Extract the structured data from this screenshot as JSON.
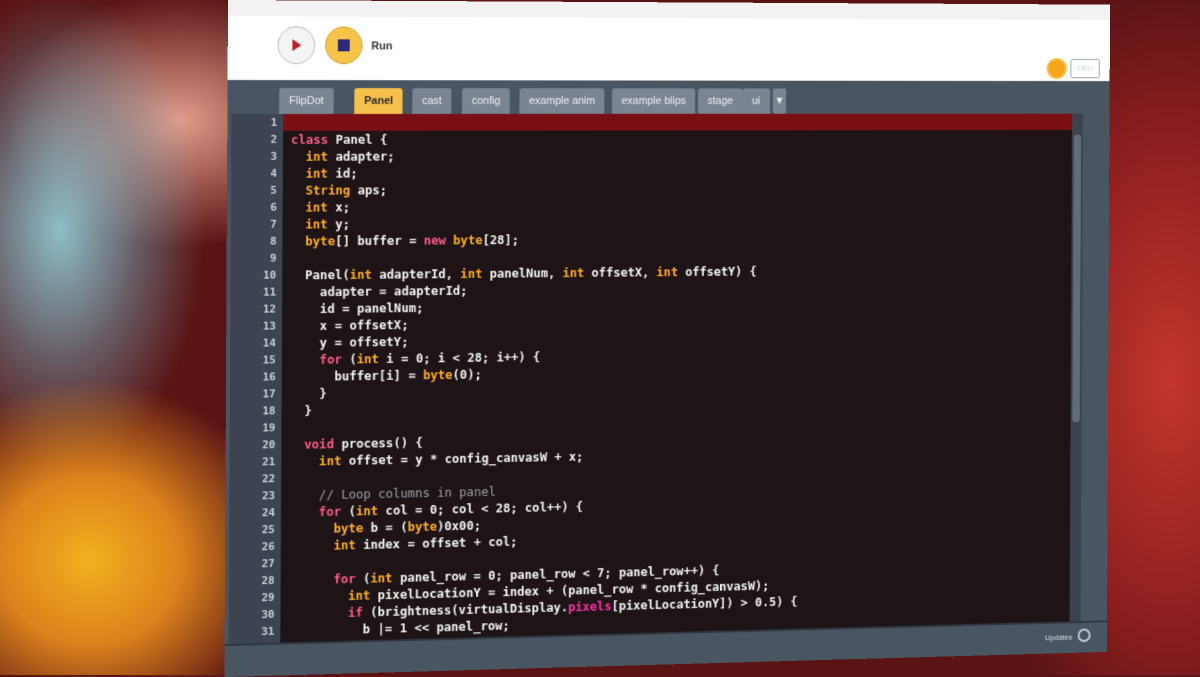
{
  "toolbar": {
    "title": "Run",
    "lang_label": "DEU"
  },
  "tabs": [
    {
      "label": "FlipDot",
      "active": false
    },
    {
      "label": "Panel",
      "active": true
    },
    {
      "label": "cast",
      "active": false
    },
    {
      "label": "config",
      "active": false
    },
    {
      "label": "example anim",
      "active": false
    },
    {
      "label": "example blips",
      "active": false
    },
    {
      "label": "stage",
      "active": false
    },
    {
      "label": "ui",
      "active": false
    }
  ],
  "editor": {
    "current_line": 1,
    "lines": [
      "",
      "class Panel {",
      "  int adapter;",
      "  int id;",
      "  String aps;",
      "  int x;",
      "  int y;",
      "  byte[] buffer = new byte[28];",
      "",
      "  Panel(int adapterId, int panelNum, int offsetX, int offsetY) {",
      "    adapter = adapterId;",
      "    id = panelNum;",
      "    x = offsetX;",
      "    y = offsetY;",
      "    for (int i = 0; i < 28; i++) {",
      "      buffer[i] = byte(0);",
      "    }",
      "  }",
      "",
      "  void process() {",
      "    int offset = y * config_canvasW + x;",
      "",
      "    // Loop columns in panel",
      "    for (int col = 0; col < 28; col++) {",
      "      byte b = (byte)0x00;",
      "      int index = offset + col;",
      "",
      "      for (int panel_row = 0; panel_row < 7; panel_row++) {",
      "        int pixelLocationY = index + (panel_row * config_canvasW);",
      "        if (brightness(virtualDisplay.pixels[pixelLocationY]) > 0.5) {",
      "          b |= 1 << panel_row;",
      "        }",
      "      }",
      ""
    ]
  },
  "console": {
    "updates_label": "Updates"
  },
  "colors": {
    "accent": "#f6c14b",
    "editor_bg": "#1e1416",
    "current_line": "#7a0f14",
    "keyword": "#ff5c8a",
    "type": "#ffb020"
  }
}
